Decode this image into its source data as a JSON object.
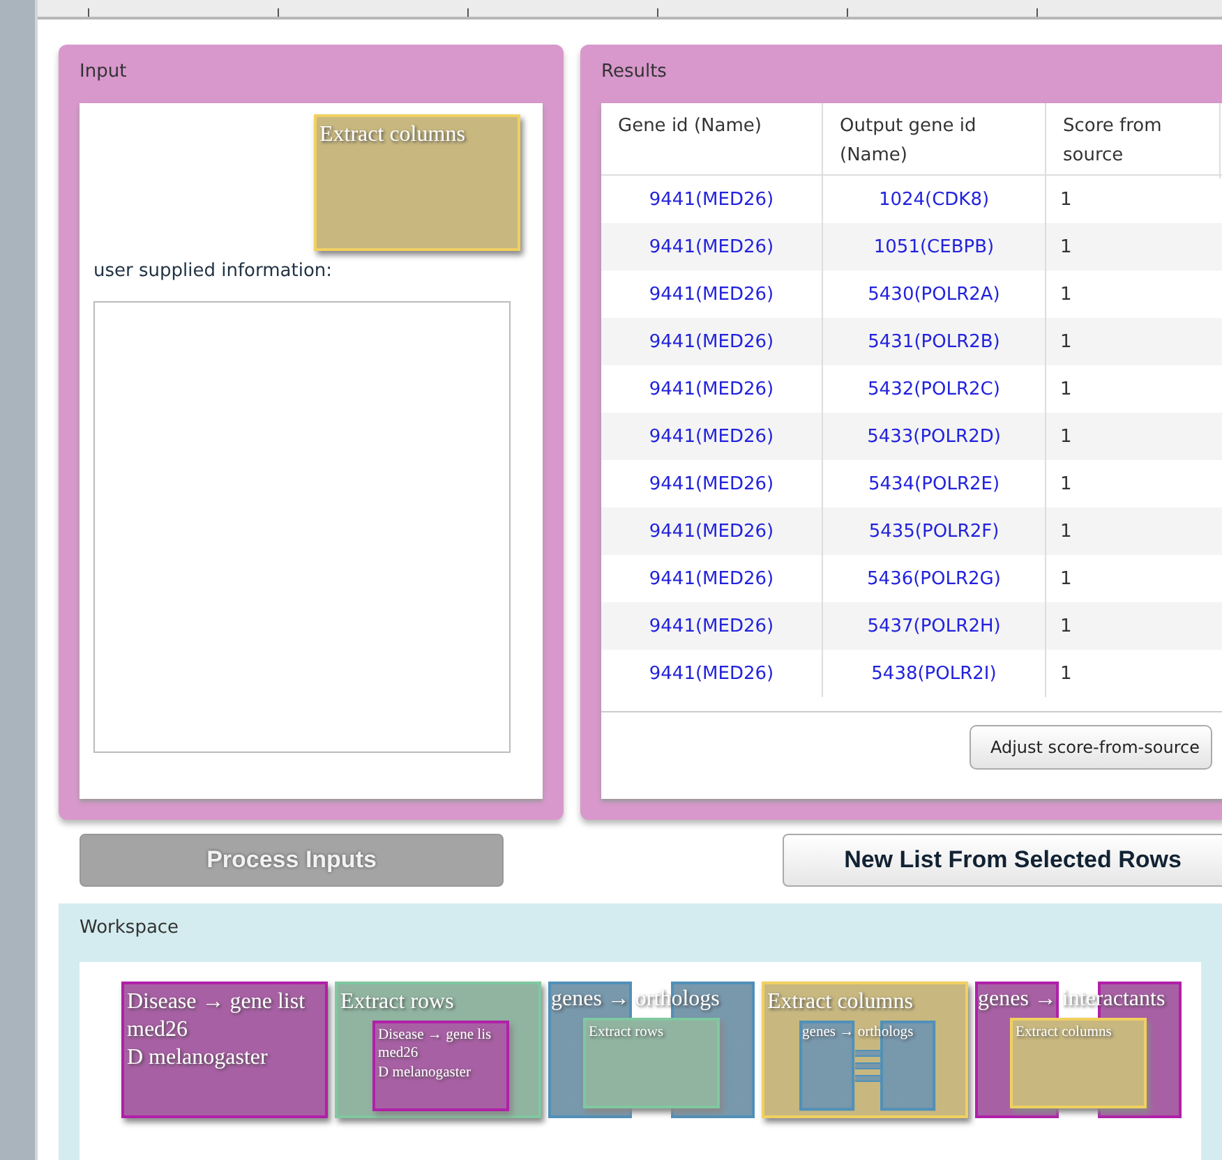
{
  "input_panel": {
    "title": "Input",
    "floating_node": {
      "color": "#f0d060",
      "kind": "single",
      "title": "Extract columns"
    },
    "field_label": "user supplied information:"
  },
  "results_panel": {
    "title": "Results",
    "columns": [
      "Gene id (Name)",
      "Output gene id (Name)",
      "Score from source"
    ],
    "rows": [
      [
        "9441(MED26)",
        "1024(CDK8)",
        "1"
      ],
      [
        "9441(MED26)",
        "1051(CEBPB)",
        "1"
      ],
      [
        "9441(MED26)",
        "5430(POLR2A)",
        "1"
      ],
      [
        "9441(MED26)",
        "5431(POLR2B)",
        "1"
      ],
      [
        "9441(MED26)",
        "5432(POLR2C)",
        "1"
      ],
      [
        "9441(MED26)",
        "5433(POLR2D)",
        "1"
      ],
      [
        "9441(MED26)",
        "5434(POLR2E)",
        "1"
      ],
      [
        "9441(MED26)",
        "5435(POLR2F)",
        "1"
      ],
      [
        "9441(MED26)",
        "5436(POLR2G)",
        "1"
      ],
      [
        "9441(MED26)",
        "5437(POLR2H)",
        "1"
      ],
      [
        "9441(MED26)",
        "5438(POLR2I)",
        "1"
      ]
    ],
    "adjust_button": "Adjust score-from-source"
  },
  "process_button": {
    "label": "Process Inputs",
    "disabled": true
  },
  "new_list_button": {
    "label": "New List From Selected Rows",
    "disabled": false
  },
  "workspace": {
    "title": "Workspace",
    "nodes": [
      {
        "color": "#b020a8",
        "kind": "single",
        "title": "Disease → gene list",
        "lines": [
          "med26",
          "D melanogaster"
        ]
      },
      {
        "color": "#80c8a0",
        "kind": "single",
        "title": "Extract rows",
        "inner": {
          "color": "#b020a8",
          "kind": "single",
          "title": "Disease → gene lis",
          "lines": [
            "med26",
            "D melanogaster"
          ]
        }
      },
      {
        "color": "#5090b8",
        "kind": "pair",
        "title": "genes → orthologs",
        "inner": {
          "color": "#80c8a0",
          "kind": "single",
          "title": "Extract rows"
        }
      },
      {
        "color": "#f0d060",
        "kind": "single",
        "title": "Extract columns",
        "inner": {
          "color": "#5090b8",
          "kind": "pair",
          "title": "genes → orthologs"
        }
      },
      {
        "color": "#b020a8",
        "kind": "pair",
        "title": "genes → interactants",
        "inner": {
          "color": "#f0d060",
          "kind": "single",
          "title": "Extract columns"
        }
      }
    ]
  }
}
